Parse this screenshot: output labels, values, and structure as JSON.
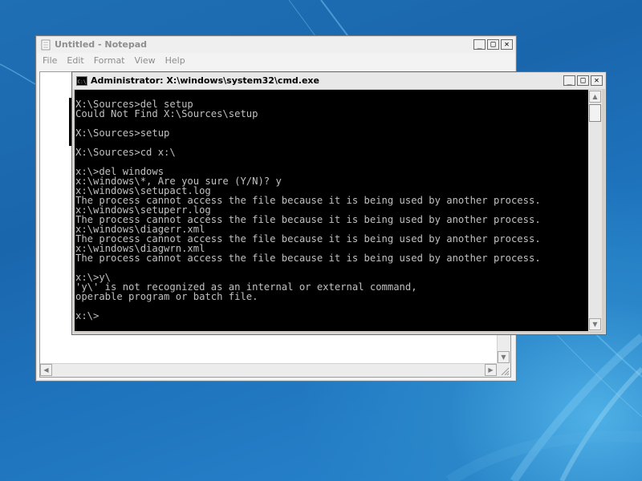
{
  "notepad": {
    "title": "Untitled - Notepad",
    "menu": [
      "File",
      "Edit",
      "Format",
      "View",
      "Help"
    ],
    "buttons": {
      "minimize": "_",
      "maximize": "□",
      "close": "✕"
    }
  },
  "cmd": {
    "title": "Administrator: X:\\windows\\system32\\cmd.exe",
    "icon_label": "C:\\",
    "buttons": {
      "minimize": "_",
      "maximize": "□",
      "close": "✕"
    },
    "lines": [
      "",
      "X:\\Sources>del setup",
      "Could Not Find X:\\Sources\\setup",
      "",
      "X:\\Sources>setup",
      "",
      "X:\\Sources>cd x:\\",
      "",
      "x:\\>del windows",
      "x:\\windows\\*, Are you sure (Y/N)? y",
      "x:\\windows\\setupact.log",
      "The process cannot access the file because it is being used by another process.",
      "x:\\windows\\setuperr.log",
      "The process cannot access the file because it is being used by another process.",
      "x:\\windows\\diagerr.xml",
      "The process cannot access the file because it is being used by another process.",
      "x:\\windows\\diagwrn.xml",
      "The process cannot access the file because it is being used by another process.",
      "",
      "x:\\>y\\",
      "'y\\' is not recognized as an internal or external command,",
      "operable program or batch file.",
      "",
      "x:\\>"
    ]
  },
  "colors": {
    "console_bg": "#000000",
    "console_fg": "#c0c0c0",
    "desktop": "#1e6fb6"
  }
}
